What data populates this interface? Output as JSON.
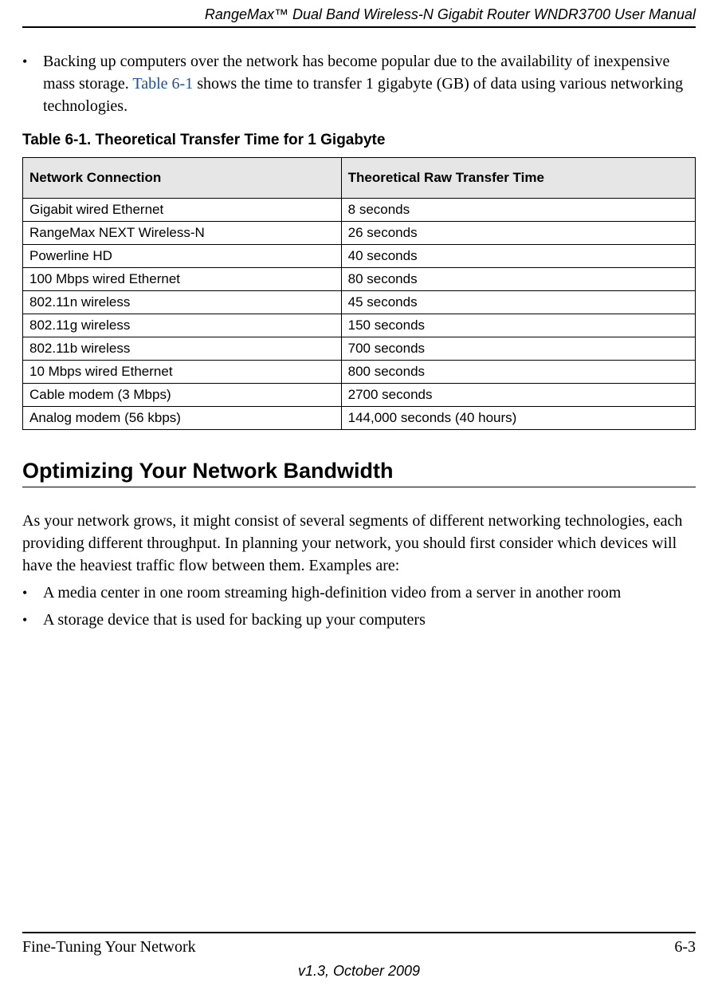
{
  "header": {
    "title": "RangeMax™ Dual Band Wireless-N Gigabit Router WNDR3700 User Manual"
  },
  "intro_bullet": {
    "pre_link": "Backing up computers over the network has become popular due to the availability of inexpensive mass storage. ",
    "link": "Table 6-1",
    "post_link": " shows the time to transfer 1 gigabyte (GB) of data using various networking technologies."
  },
  "table": {
    "caption": "Table 6-1.  Theoretical Transfer Time for 1 Gigabyte",
    "headers": [
      "Network Connection",
      "Theoretical Raw Transfer Time"
    ],
    "rows": [
      [
        "Gigabit wired Ethernet",
        "8 seconds"
      ],
      [
        "RangeMax NEXT Wireless-N",
        "26 seconds"
      ],
      [
        "Powerline HD",
        "40 seconds"
      ],
      [
        "100 Mbps wired Ethernet",
        "80 seconds"
      ],
      [
        "802.11n wireless",
        "45 seconds"
      ],
      [
        "802.11g wireless",
        "150 seconds"
      ],
      [
        "802.11b wireless",
        "700 seconds"
      ],
      [
        "10 Mbps wired Ethernet",
        "800 seconds"
      ],
      [
        "Cable modem (3 Mbps)",
        "2700 seconds"
      ],
      [
        "Analog modem (56 kbps)",
        "144,000 seconds (40 hours)"
      ]
    ]
  },
  "section": {
    "heading": "Optimizing Your Network Bandwidth",
    "paragraph": "As your network grows, it might consist of several segments of different networking technologies, each providing different throughput. In planning your network, you should first consider which devices will have the heaviest traffic flow between them. Examples are:",
    "bullets": [
      "A media center in one room streaming high-definition video from a server in another room",
      "A storage device that is used for backing up your computers"
    ]
  },
  "footer": {
    "chapter": "Fine-Tuning Your Network",
    "page": "6-3",
    "version": "v1.3, October 2009"
  },
  "chart_data": {
    "type": "table",
    "title": "Theoretical Transfer Time for 1 Gigabyte",
    "columns": [
      "Network Connection",
      "Theoretical Raw Transfer Time"
    ],
    "rows": [
      {
        "connection": "Gigabit wired Ethernet",
        "time": "8 seconds"
      },
      {
        "connection": "RangeMax NEXT Wireless-N",
        "time": "26 seconds"
      },
      {
        "connection": "Powerline HD",
        "time": "40 seconds"
      },
      {
        "connection": "100 Mbps wired Ethernet",
        "time": "80 seconds"
      },
      {
        "connection": "802.11n wireless",
        "time": "45 seconds"
      },
      {
        "connection": "802.11g wireless",
        "time": "150 seconds"
      },
      {
        "connection": "802.11b wireless",
        "time": "700 seconds"
      },
      {
        "connection": "10 Mbps wired Ethernet",
        "time": "800 seconds"
      },
      {
        "connection": "Cable modem (3 Mbps)",
        "time": "2700 seconds"
      },
      {
        "connection": "Analog modem (56 kbps)",
        "time": "144,000 seconds (40 hours)"
      }
    ]
  }
}
